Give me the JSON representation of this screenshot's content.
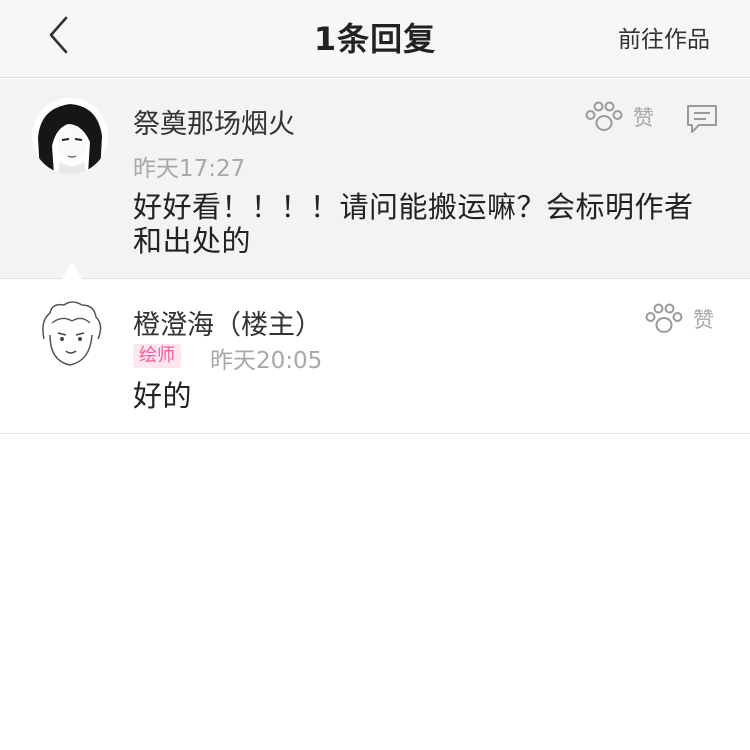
{
  "header": {
    "title": "1条回复",
    "right_label": "前往作品"
  },
  "comment": {
    "username": "祭奠那场烟火",
    "time": "昨天17:27",
    "content_line1": "好好看！！！！请问能搬运嘛？会标明作者",
    "content_line2": "和出处的",
    "like_label": "赞"
  },
  "reply": {
    "username": "橙澄海（楼主）",
    "badge": "绘师",
    "time": "昨天20:05",
    "content": "好的",
    "like_label": "赞"
  },
  "colors": {
    "badge_bg": "#fde6ef",
    "badge_text": "#ee5f95",
    "header_bg": "#f7f7f7",
    "highlight_bg": "#f3f3f3"
  },
  "icons": {
    "back": "chevron-left-icon",
    "like": "paw-icon",
    "reply": "comment-icon"
  }
}
